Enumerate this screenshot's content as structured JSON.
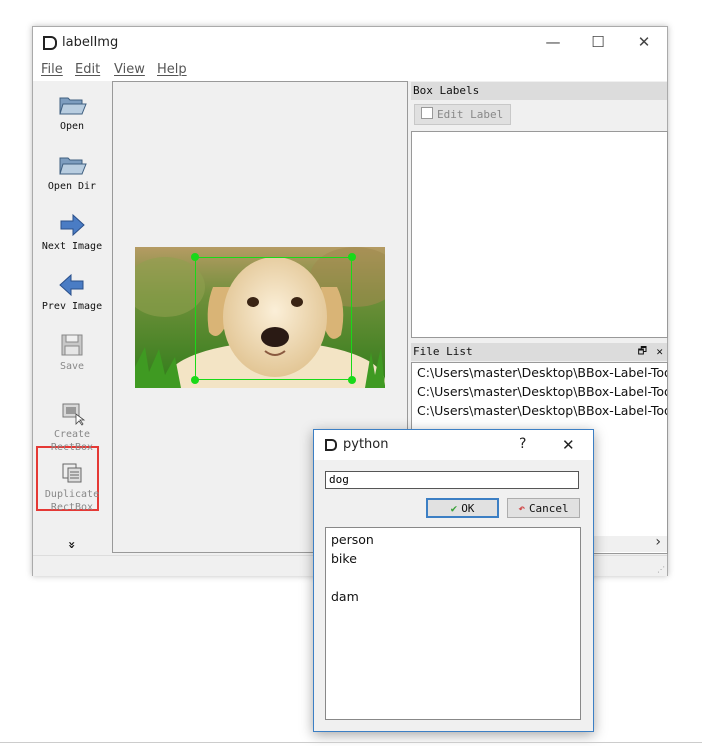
{
  "window": {
    "title": "labelImg",
    "minimize": "—",
    "maximize": "☐",
    "close": "✕"
  },
  "menu": [
    "File",
    "Edit",
    "View",
    "Help"
  ],
  "toolbar": {
    "open": "Open",
    "open_dir": "Open Dir",
    "next_image": "Next Image",
    "prev_image": "Prev Image",
    "save": "Save",
    "create_line1": "Create",
    "create_line2": "RectBox",
    "duplicate_line1": "Duplicate",
    "duplicate_line2": "RectBox",
    "more": "»"
  },
  "box_labels": {
    "title": "Box Labels",
    "edit_label": "Edit Label"
  },
  "file_list": {
    "title": "File List",
    "float_icon": "🗗",
    "close_icon": "✕",
    "files": [
      "C:\\Users\\master\\Desktop\\BBox-Label-Tool",
      "C:\\Users\\master\\Desktop\\BBox-Label-Tool",
      "C:\\Users\\master\\Desktop\\BBox-Label-Tool"
    ],
    "scroll_arrow": "›"
  },
  "dialog": {
    "title": "python",
    "help": "?",
    "close": "✕",
    "input_value": "dog",
    "ok_label": "OK",
    "cancel_label": "Cancel",
    "classes": [
      "person",
      "bike",
      "",
      "dam"
    ]
  },
  "colors": {
    "bbox": "#19d919",
    "highlight": "#e53935",
    "accent": "#3c7fc4"
  }
}
